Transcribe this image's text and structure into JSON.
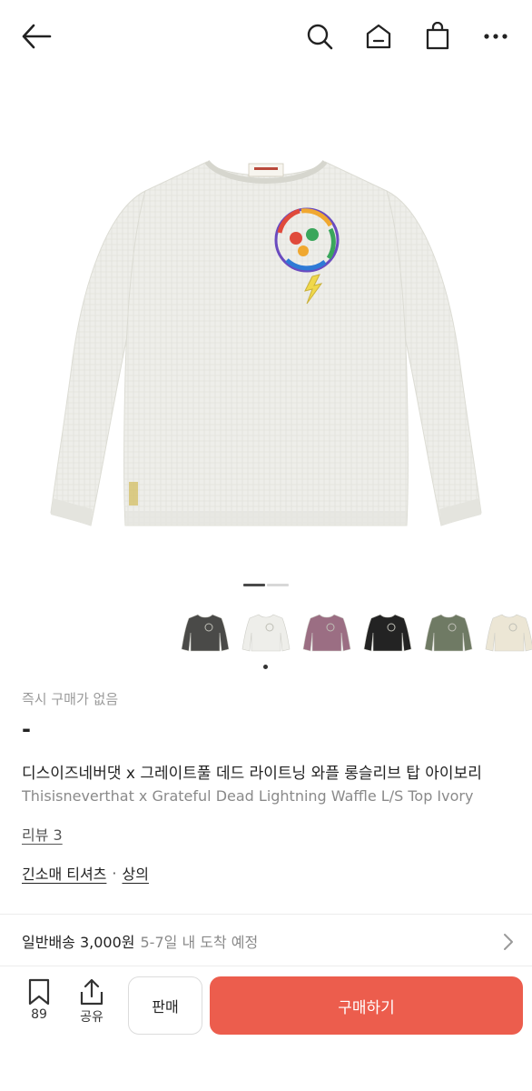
{
  "topbar": {
    "back_icon": "arrow-left-icon",
    "search_icon": "search-icon",
    "home_icon": "home-icon",
    "bag_icon": "shopping-bag-icon",
    "more_icon": "more-horizontal-icon"
  },
  "gallery": {
    "page_count": 2,
    "active_page": 1,
    "hero_color": "#eeeeea",
    "thumbnails": [
      {
        "name": "charcoal",
        "color": "#4a4a48"
      },
      {
        "name": "ivory",
        "color": "#eeeeea"
      },
      {
        "name": "purple",
        "color": "#9b6e83"
      },
      {
        "name": "black",
        "color": "#232323"
      },
      {
        "name": "olive",
        "color": "#6f7a64"
      },
      {
        "name": "cream",
        "color": "#ece6d5"
      }
    ]
  },
  "product": {
    "instant_purchase": "즉시 구매가 없음",
    "price": "-",
    "title_ko": "디스이즈네버댓 x 그레이트풀 데드 라이트닝 와플 롱슬리브 탑 아이보리",
    "title_en": "Thisisneverthat x Grateful Dead Lightning Waffle L/S Top Ivory",
    "review_label": "리뷰 3",
    "category_primary": "긴소매 티셔츠",
    "category_separator": "·",
    "category_secondary": "상의"
  },
  "shipping": {
    "label": "일반배송 3,000원",
    "eta": "5-7일 내 도착 예정"
  },
  "bottom": {
    "wish_count": "89",
    "share_label": "공유",
    "sell_label": "판매",
    "buy_label": "구매하기",
    "buy_color": "#ec5d4d"
  }
}
